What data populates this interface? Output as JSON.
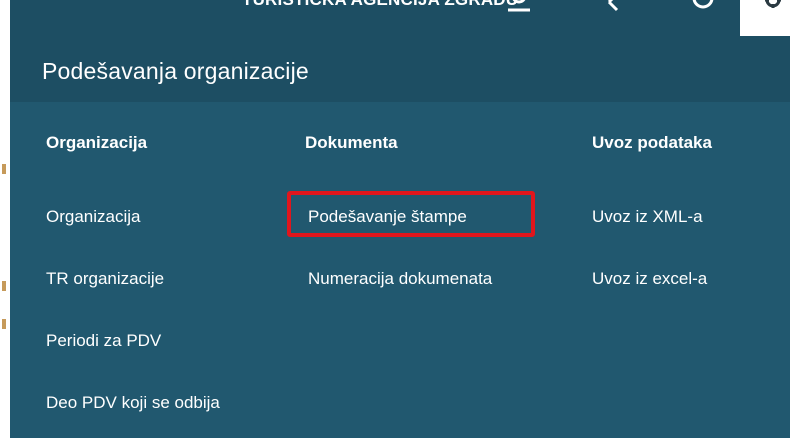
{
  "topbar": {
    "user_text": "TURISTICKA AGENCIJA ZGRADU",
    "icons": [
      "user-icon",
      "arrow-icon",
      "help-icon",
      "gear-icon"
    ]
  },
  "panel": {
    "title": "Podešavanja organizacije",
    "columns": [
      {
        "heading": "Organizacija",
        "items": [
          "Organizacija",
          "TR organizacije",
          "Periodi za PDV",
          "Deo PDV koji se odbija"
        ]
      },
      {
        "heading": "Dokumenta",
        "items": [
          "Podešavanje štampe",
          "Numeracija dokumenata"
        ]
      },
      {
        "heading": "Uvoz podataka",
        "items": [
          "Uvoz iz XML-a",
          "Uvoz iz excel-a"
        ]
      }
    ]
  },
  "colors": {
    "panel_bg": "#21586f",
    "header_bg": "#1d4e63",
    "highlight": "#e0161d"
  }
}
